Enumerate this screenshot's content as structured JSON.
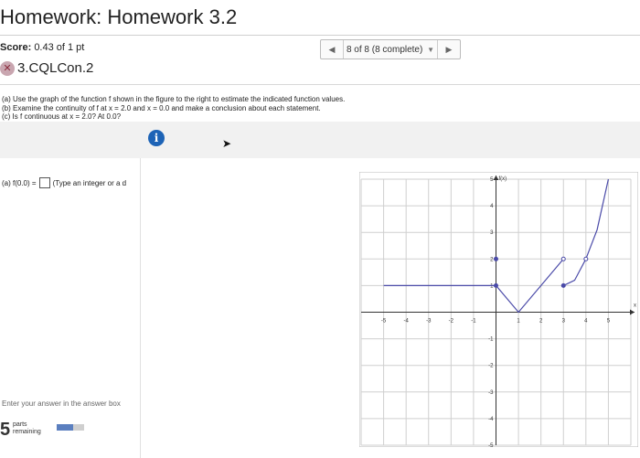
{
  "header": {
    "title": "Homework: Homework 3.2"
  },
  "score": {
    "label": "Score:",
    "value": "0.43 of 1 pt"
  },
  "nav": {
    "prev_glyph": "◀",
    "status": "8 of 8 (8 complete)",
    "dropdown_glyph": "▼",
    "next_glyph": "▶"
  },
  "question": {
    "status_glyph": "✕",
    "id": "3.CQLCon.2"
  },
  "instructions": [
    "(a) Use the graph of the function f shown in the figure to the right to estimate the indicated function values.",
    "(b) Examine the continuity of f at x = 2.0 and x = 0.0 and make a conclusion about each statement.",
    "(c) Is f continuous at x = 2.0? At 0.0?"
  ],
  "info_icon_glyph": "i",
  "part_a": {
    "prefix": "(a)  f(0.0) =",
    "hint": "(Type an integer or a d"
  },
  "answer_note": "Enter your answer in the answer box",
  "parts": {
    "count": "5",
    "line1": "parts",
    "line2": "remaining",
    "progress": 0.6
  },
  "chart_data": {
    "type": "line",
    "title": "",
    "ylabel": "f(x)",
    "xlabel": "x",
    "xlim": [
      -6,
      6
    ],
    "ylim": [
      -5,
      5
    ],
    "x_ticks": [
      "-5",
      "-4",
      "-3",
      "-2",
      "-1",
      "1",
      "2",
      "3",
      "4",
      "5"
    ],
    "y_ticks": [
      "5",
      "4",
      "3",
      "2",
      "1",
      "-1",
      "-2",
      "-3",
      "-4",
      "-5"
    ],
    "grid": true,
    "series": [
      {
        "points": [
          [
            -5,
            1
          ],
          [
            0,
            1
          ],
          [
            1,
            0
          ],
          [
            3,
            2
          ]
        ]
      },
      {
        "points": [
          [
            3,
            1
          ],
          [
            3.5,
            1.2
          ],
          [
            4,
            2
          ],
          [
            4.5,
            3.1
          ],
          [
            5,
            5
          ]
        ]
      }
    ],
    "markers": [
      {
        "x": 0,
        "y": 1,
        "style": "filled"
      },
      {
        "x": 0,
        "y": 2,
        "style": "filled"
      },
      {
        "x": 3,
        "y": 2,
        "style": "open"
      },
      {
        "x": 3,
        "y": 1,
        "style": "filled"
      },
      {
        "x": 4,
        "y": 2,
        "style": "open"
      }
    ],
    "colors": {
      "curve": "#4a4aa8",
      "grid": "#cfcfcf",
      "axis": "#333333"
    }
  }
}
